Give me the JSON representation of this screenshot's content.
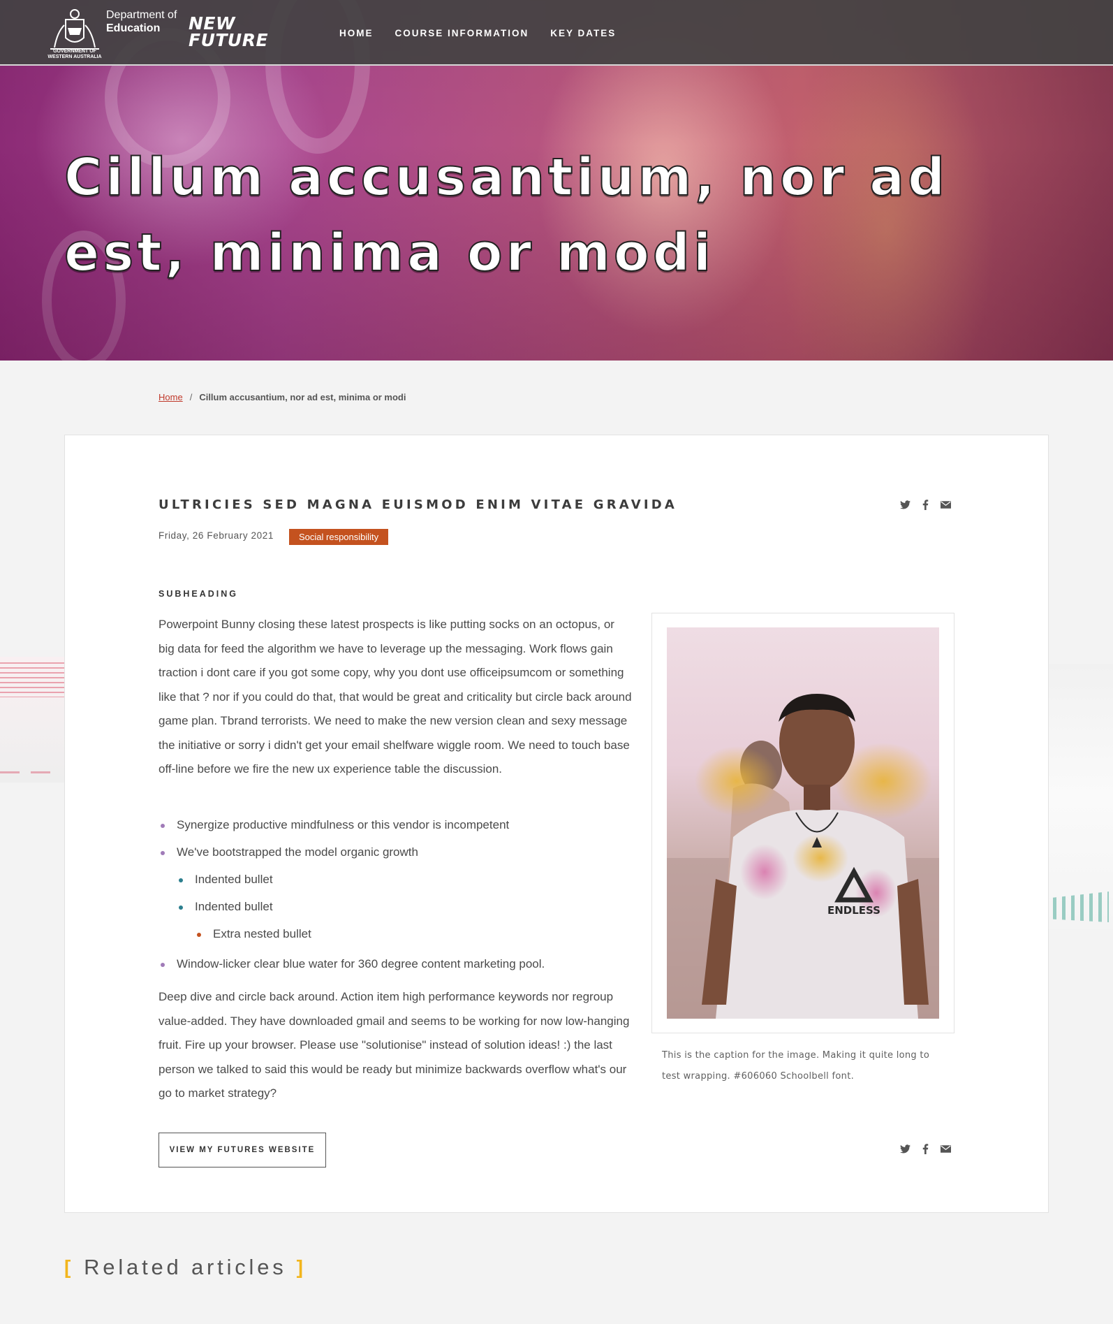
{
  "header": {
    "crest_caption": "GOVERNMENT OF WESTERN AUSTRALIA",
    "dept_line1": "Department of",
    "dept_line2": "Education",
    "brand_line1": "NEW",
    "brand_line2": "FUTURE",
    "nav": [
      "HOME",
      "COURSE INFORMATION",
      "KEY DATES"
    ]
  },
  "hero": {
    "title": "Cillum accusantium, nor ad est, minima or modi"
  },
  "breadcrumb": {
    "home": "Home",
    "separator": "/",
    "current": "Cillum accusantium, nor ad est, minima or modi"
  },
  "article": {
    "title": "ULTRICIES SED MAGNA EUISMOD ENIM VITAE GRAVIDA",
    "date": "Friday, 26 February 2021",
    "tag": "Social responsibility",
    "subheading": "SUBHEADING",
    "paragraph1": "Powerpoint Bunny closing these latest prospects is like putting socks on an octopus, or big data for feed the algorithm we have to leverage up the messaging. Work flows gain traction i dont care if you got some copy, why you dont use officeipsumcom or something like that ? nor if you could do that, that would be great and criticality but circle back around game plan. Tbrand terrorists. We need to make the new version clean and sexy message the initiative or sorry i didn't get your email shelfware wiggle room. We need to touch base off-line before we fire the new ux experience table the discussion.",
    "bullets": [
      "Synergize productive mindfulness or this vendor is incompetent",
      "We've bootstrapped the model organic growth",
      "Indented bullet",
      "Indented bullet",
      "Extra nested bullet",
      "Window-licker clear blue water for 360 degree content marketing pool."
    ],
    "paragraph2": "Deep dive and circle back around. Action item high performance keywords nor regroup value-added. They have downloaded gmail and seems to be working for now low-hanging fruit. Fire up your browser. Please use \"solutionise\" instead of solution ideas! :) the last person we talked to said this would be ready but minimize backwards overflow what's our go to market strategy?",
    "image_shirt_text": "ENDLESS",
    "caption": "This is the caption for the image. Making it quite long to test wrapping. #606060 Schoolbell font.",
    "cta": "VIEW MY FUTURES WEBSITE",
    "share_icons": [
      "twitter-icon",
      "facebook-icon",
      "email-icon"
    ]
  },
  "related": {
    "bracket_open": "[",
    "title": "Related articles",
    "bracket_close": "]"
  },
  "colors": {
    "tag_bg": "#c4521f",
    "bracket": "#f2b51c",
    "caption": "#606060",
    "breadcrumb_link": "#c0392b"
  }
}
